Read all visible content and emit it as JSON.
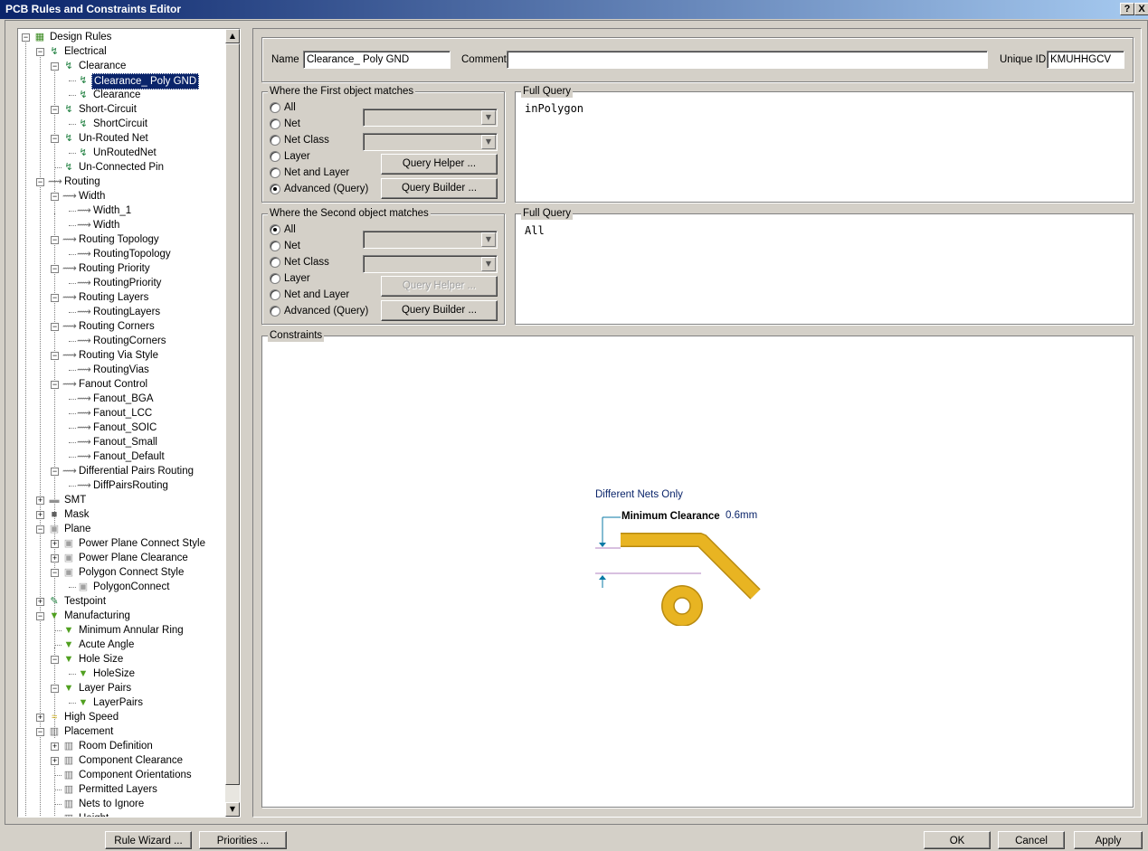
{
  "window": {
    "title": "PCB Rules and Constraints Editor",
    "help_label": "?",
    "close_label": "X"
  },
  "tree": {
    "items": [
      {
        "label": "Design Rules",
        "selected": false
      },
      {
        "label": "Electrical",
        "selected": false
      },
      {
        "label": "Clearance",
        "selected": false
      },
      {
        "label": "Clearance_ Poly GND",
        "selected": true
      },
      {
        "label": "Clearance",
        "selected": false
      },
      {
        "label": "Short-Circuit",
        "selected": false
      },
      {
        "label": "ShortCircuit",
        "selected": false
      },
      {
        "label": "Un-Routed Net",
        "selected": false
      },
      {
        "label": "UnRoutedNet",
        "selected": false
      },
      {
        "label": "Un-Connected Pin",
        "selected": false
      },
      {
        "label": "Routing",
        "selected": false
      },
      {
        "label": "Width",
        "selected": false
      },
      {
        "label": "Width_1",
        "selected": false
      },
      {
        "label": "Width",
        "selected": false
      },
      {
        "label": "Routing Topology",
        "selected": false
      },
      {
        "label": "RoutingTopology",
        "selected": false
      },
      {
        "label": "Routing Priority",
        "selected": false
      },
      {
        "label": "RoutingPriority",
        "selected": false
      },
      {
        "label": "Routing Layers",
        "selected": false
      },
      {
        "label": "RoutingLayers",
        "selected": false
      },
      {
        "label": "Routing Corners",
        "selected": false
      },
      {
        "label": "RoutingCorners",
        "selected": false
      },
      {
        "label": "Routing Via Style",
        "selected": false
      },
      {
        "label": "RoutingVias",
        "selected": false
      },
      {
        "label": "Fanout Control",
        "selected": false
      },
      {
        "label": "Fanout_BGA",
        "selected": false
      },
      {
        "label": "Fanout_LCC",
        "selected": false
      },
      {
        "label": "Fanout_SOIC",
        "selected": false
      },
      {
        "label": "Fanout_Small",
        "selected": false
      },
      {
        "label": "Fanout_Default",
        "selected": false
      },
      {
        "label": "Differential Pairs Routing",
        "selected": false
      },
      {
        "label": "DiffPairsRouting",
        "selected": false
      },
      {
        "label": "SMT",
        "selected": false
      },
      {
        "label": "Mask",
        "selected": false
      },
      {
        "label": "Plane",
        "selected": false
      },
      {
        "label": "Power Plane Connect Style",
        "selected": false
      },
      {
        "label": "Power Plane Clearance",
        "selected": false
      },
      {
        "label": "Polygon Connect Style",
        "selected": false
      },
      {
        "label": "PolygonConnect",
        "selected": false
      },
      {
        "label": "Testpoint",
        "selected": false
      },
      {
        "label": "Manufacturing",
        "selected": false
      },
      {
        "label": "Minimum Annular Ring",
        "selected": false
      },
      {
        "label": "Acute Angle",
        "selected": false
      },
      {
        "label": "Hole Size",
        "selected": false
      },
      {
        "label": "HoleSize",
        "selected": false
      },
      {
        "label": "Layer Pairs",
        "selected": false
      },
      {
        "label": "LayerPairs",
        "selected": false
      },
      {
        "label": "High Speed",
        "selected": false
      },
      {
        "label": "Placement",
        "selected": false
      },
      {
        "label": "Room Definition",
        "selected": false
      },
      {
        "label": "Component Clearance",
        "selected": false
      },
      {
        "label": "Component Orientations",
        "selected": false
      },
      {
        "label": "Permitted Layers",
        "selected": false
      },
      {
        "label": "Nets to Ignore",
        "selected": false
      },
      {
        "label": "Height",
        "selected": false
      }
    ]
  },
  "rule": {
    "name_label": "Name",
    "name_value": "Clearance_ Poly GND",
    "comment_label": "Comment",
    "comment_value": "",
    "uid_label": "Unique ID",
    "uid_value": "KMUHHGCV"
  },
  "first_match": {
    "title": "Where the First object matches",
    "options": [
      "All",
      "Net",
      "Net Class",
      "Layer",
      "Net and Layer",
      "Advanced (Query)"
    ],
    "selected": "Advanced (Query)",
    "query_helper": "Query Helper ...",
    "query_builder": "Query Builder ...",
    "full_query_title": "Full Query",
    "full_query": "inPolygon"
  },
  "second_match": {
    "title": "Where the Second object matches",
    "options": [
      "All",
      "Net",
      "Net Class",
      "Layer",
      "Net and Layer",
      "Advanced (Query)"
    ],
    "selected": "All",
    "query_helper": "Query Helper ...",
    "query_builder": "Query Builder ...",
    "full_query_title": "Full Query",
    "full_query": "All"
  },
  "constraints": {
    "title": "Constraints",
    "scope_label": "Different Nets Only",
    "min_clearance_label": "Minimum Clearance",
    "min_clearance_value": "0.6mm",
    "track_color": "#e8b422",
    "track_edge_color": "#b88a10"
  },
  "bottom_buttons": [
    "Rule Wizard ...",
    "Priorities ...",
    "OK",
    "Cancel",
    "Apply"
  ]
}
